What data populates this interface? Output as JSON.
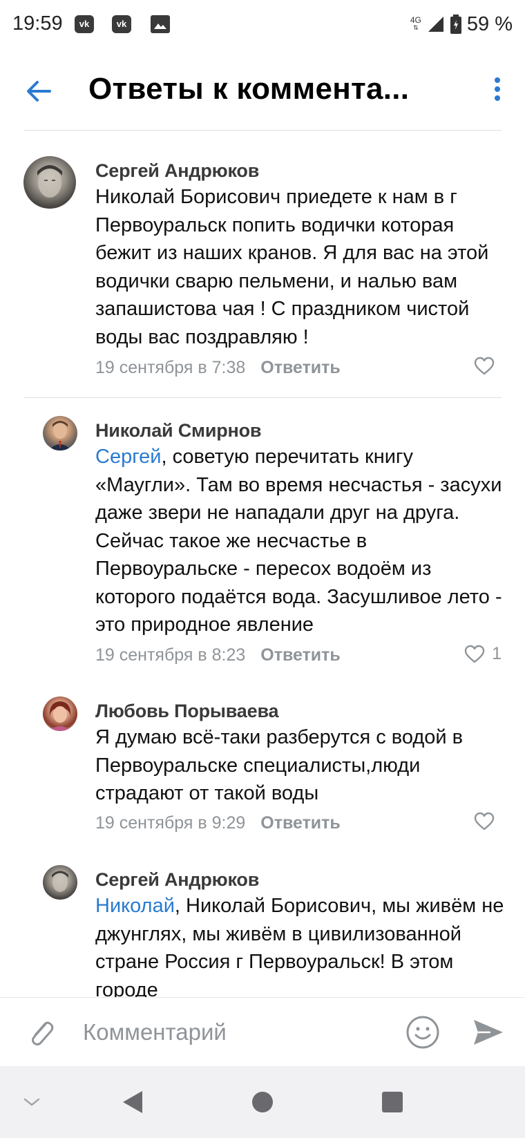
{
  "status_bar": {
    "time": "19:59",
    "notifications": [
      "vk-icon",
      "vk-icon",
      "image-icon"
    ],
    "vk_badge_text": "vk",
    "network": "4G",
    "battery": "59 %"
  },
  "header": {
    "title": "Ответы к коммента..."
  },
  "comments": [
    {
      "author": "Сергей Андрюков",
      "mention": "",
      "text": "Николай Борисович приедете к нам в г Первоуральск попить водички которая бежит из наших кранов. Я для вас на этой водички сварю пельмени, и налью вам запашистова чая ! С праздником чистой воды вас поздравляю !",
      "date": "19 сентября в 7:38",
      "reply_label": "Ответить",
      "likes": ""
    },
    {
      "author": "Николай Смирнов",
      "mention": "Сергей",
      "text": ", советую перечитать книгу «Маугли».  Там во время несчастья - засухи даже звери не нападали друг на друга. Сейчас такое же несчастье в Первоуральске - пересох водоём из которого подаётся вода. Засушливое лето - это природное явление",
      "date": "19 сентября в 8:23",
      "reply_label": "Ответить",
      "likes": "1"
    },
    {
      "author": "Любовь Порываева",
      "mention": "",
      "text": "Я думаю всё-таки разберутся с  водой в Первоуральске специалисты,люди страдают от такой воды",
      "date": "19 сентября в 9:29",
      "reply_label": "Ответить",
      "likes": ""
    },
    {
      "author": "Сергей Андрюков",
      "mention": "Николай",
      "text": ", Николай Борисович, мы живём не джунглях, мы живём в цивилизованной стране Россия г Первоуральск! В этом городе",
      "date": "",
      "reply_label": "",
      "likes": ""
    }
  ],
  "input": {
    "placeholder": "Комментарий"
  },
  "colors": {
    "accent": "#2a7ad0",
    "meta_gray": "#8f9499",
    "divider": "#dcdde0",
    "nav_bg": "#f1f1f3"
  }
}
